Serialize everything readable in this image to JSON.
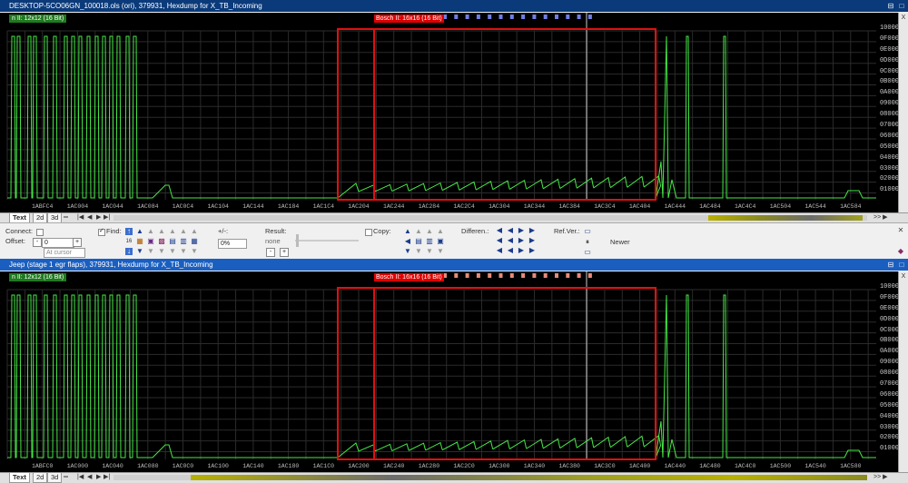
{
  "colors": {
    "title_bg": "#0a3a7a",
    "title_bg2": "#1a5fc0",
    "map_box": "#ff2a2a",
    "curve": "#46e846",
    "grid": "#303030"
  },
  "top_window": {
    "title": "DESKTOP-5CO06GN_100018.ols (ori), 379931, Hexdump for X_TB_Incoming",
    "left_tag": "n II: 12x12 (16 Bit)",
    "map_tag": "Bosch II: 16x16 (16 Bit)",
    "x_labels": [
      "1ABFC4",
      "1AC004",
      "1AC044",
      "1AC084",
      "1AC0C4",
      "1AC104",
      "1AC144",
      "1AC184",
      "1AC1C4",
      "1AC204",
      "1AC244",
      "1AC284",
      "1AC2C4",
      "1AC304",
      "1AC344",
      "1AC384",
      "1AC3C4",
      "1AC404",
      "1AC444",
      "1AC484",
      "1AC4C4",
      "1AC504",
      "1AC544",
      "1AC584"
    ]
  },
  "bottom_window": {
    "title": "Jeep (stage 1 egr flaps), 379931, Hexdump for X_TB_Incoming",
    "left_tag": "n II: 12x12 (16 Bit)",
    "map_tag": "Bosch II: 16x16 (16 Bit)",
    "x_labels": [
      "1ABFC0",
      "1AC000",
      "1AC040",
      "1AC080",
      "1AC0C0",
      "1AC100",
      "1AC140",
      "1AC180",
      "1AC1C0",
      "1AC200",
      "1AC240",
      "1AC280",
      "1AC2C0",
      "1AC300",
      "1AC340",
      "1AC380",
      "1AC3C0",
      "1AC400",
      "1AC440",
      "1AC480",
      "1AC4C0",
      "1AC500",
      "1AC540",
      "1AC580"
    ]
  },
  "y_labels": [
    "10000",
    "0F000",
    "0E000",
    "0D000",
    "0C000",
    "0B000",
    "0A000",
    "09000",
    "08000",
    "07000",
    "06000",
    "05000",
    "04000",
    "03000",
    "02000",
    "01000"
  ],
  "view_tabs": [
    "Text",
    "2d",
    "3d"
  ],
  "toolbar": {
    "connect_label": "Connect:",
    "offset_label": "Offset:",
    "offset_value": "0",
    "at_cursor": "At cursor",
    "find_label": "Find:",
    "plusminus_label": "+/-:",
    "percent_value": "0%",
    "result_label": "Result:",
    "result_value": "none",
    "copy_label": "Copy:",
    "differen_label": "Differen.:",
    "refver_label": "Ref.Ver.:",
    "newer_label": "Newer"
  },
  "sidebar_icons": [
    "close-icon",
    "gear-icon"
  ],
  "close_glyph": "X"
}
